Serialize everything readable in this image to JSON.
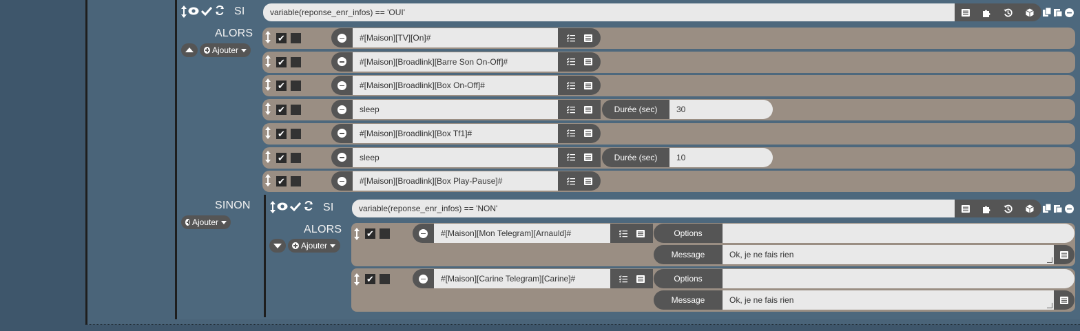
{
  "si_top": {
    "label": "SI",
    "condition": "variable(reponse_enr_infos) == 'OUI'",
    "then_label": "ALORS",
    "add_label": "Ajouter",
    "actions": [
      {
        "cmd": "#[Maison][TV][On]#"
      },
      {
        "cmd": "#[Maison][Broadlink][Barre Son On-Off]#"
      },
      {
        "cmd": "#[Maison][Broadlink][Box On-Off]#"
      },
      {
        "cmd": "sleep",
        "opt_label": "Durée (sec)",
        "opt_value": "30"
      },
      {
        "cmd": "#[Maison][Broadlink][Box Tf1]#"
      },
      {
        "cmd": "sleep",
        "opt_label": "Durée (sec)",
        "opt_value": "10"
      },
      {
        "cmd": "#[Maison][Broadlink][Box Play-Pause]#"
      }
    ]
  },
  "sinon": {
    "label": "SINON",
    "add_label": "Ajouter",
    "nested_si": {
      "label": "SI",
      "condition": "variable(reponse_enr_infos) == 'NON'",
      "then_label": "ALORS",
      "add_label": "Ajouter",
      "actions": [
        {
          "cmd": "#[Maison][Mon Telegram][Arnauld]#",
          "options_label": "Options",
          "options_value": "",
          "message_label": "Message",
          "message_value": "Ok, je ne fais rien"
        },
        {
          "cmd": "#[Maison][Carine Telegram][Carine]#",
          "options_label": "Options",
          "options_value": "",
          "message_label": "Message",
          "message_value": "Ok, je ne fais rien"
        }
      ]
    }
  },
  "icons": [
    "move-vertical-icon",
    "eye-icon",
    "check-icon",
    "refresh-icon",
    "list-icon",
    "puzzle-icon",
    "history-icon",
    "cube-icon",
    "copy-icon",
    "minus-circle-icon",
    "tasks-icon",
    "plus-circle-icon",
    "caret-down-icon"
  ],
  "colors": {
    "background": "#3e566b",
    "panel": "#4d687d",
    "row": "#9a8e83",
    "button_dark": "#555555",
    "input": "#e9e9e9"
  }
}
